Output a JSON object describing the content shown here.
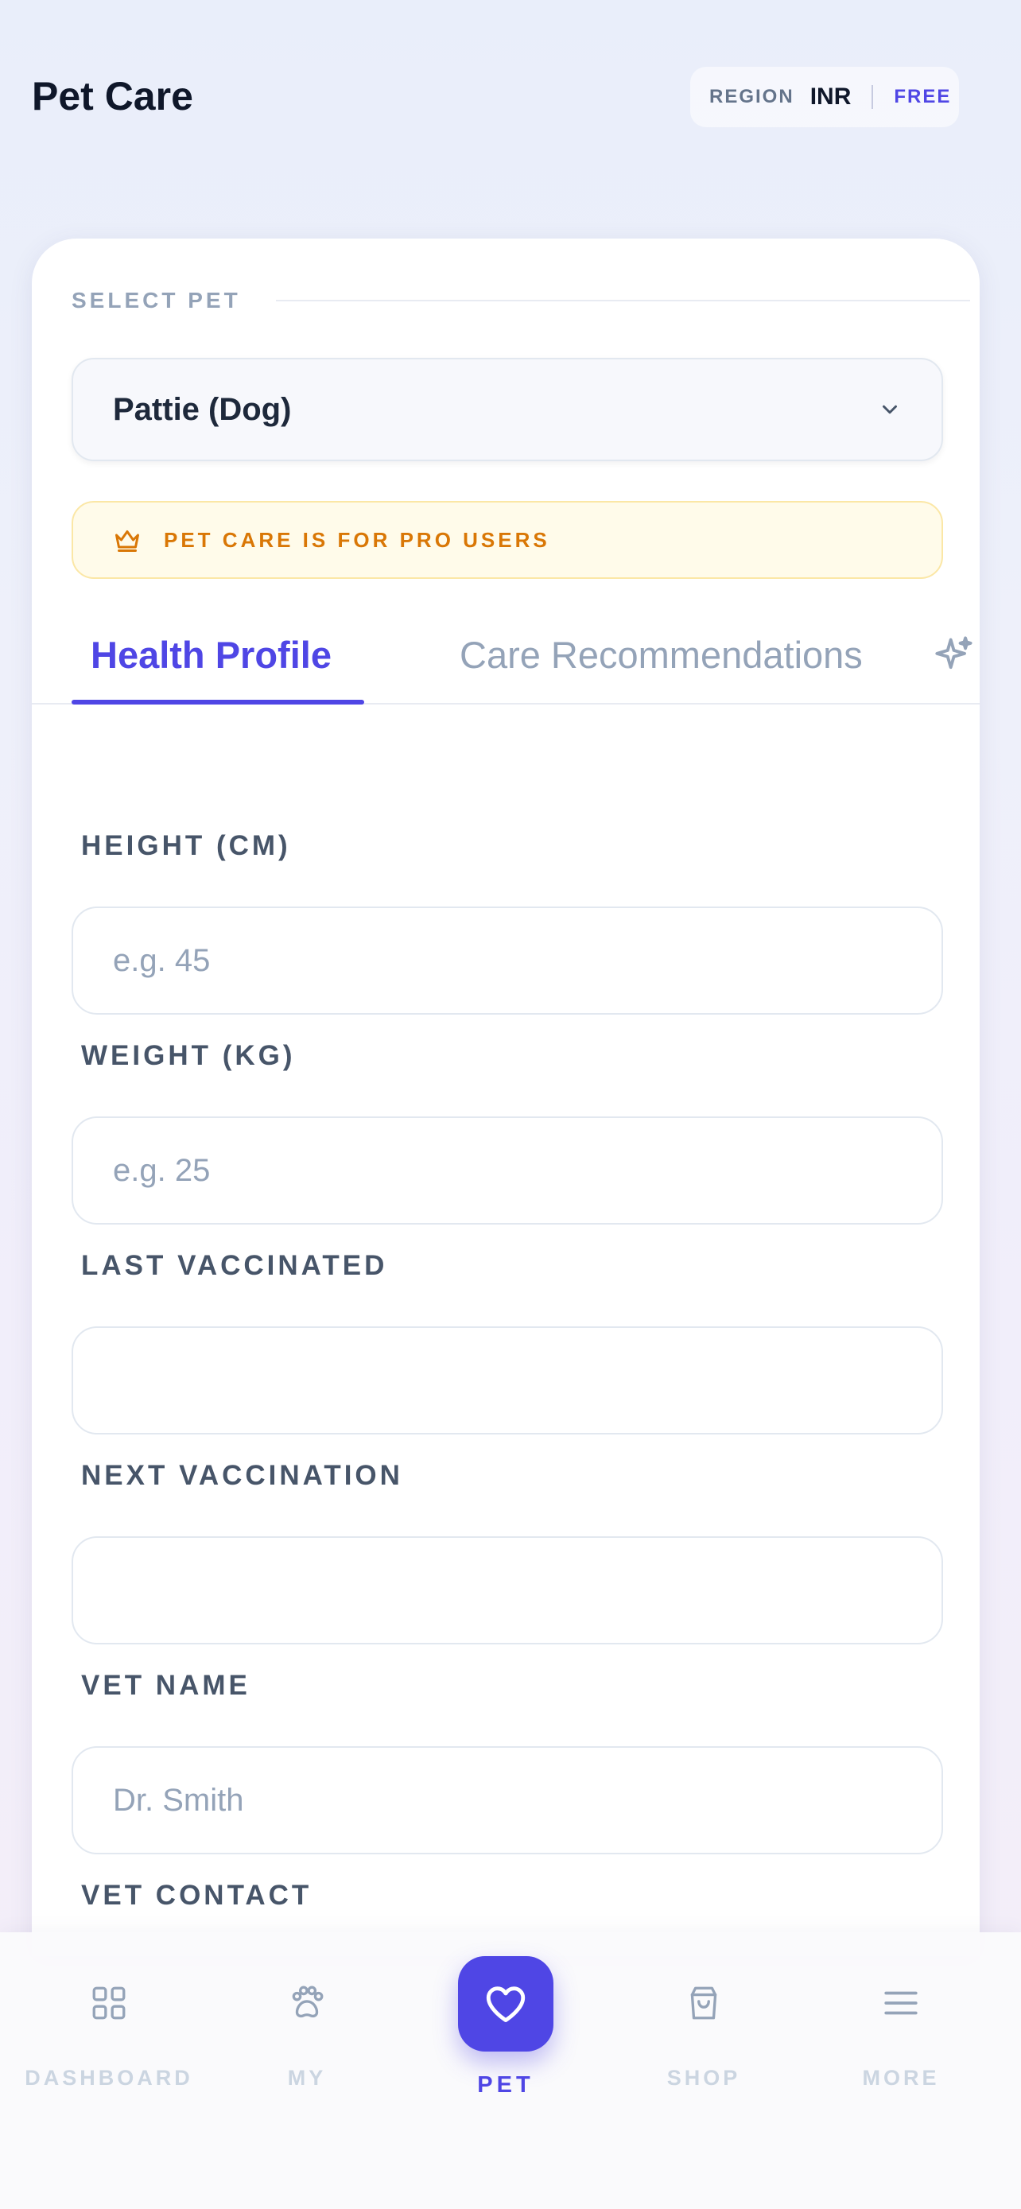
{
  "header": {
    "title": "Pet Care",
    "region_label": "REGION",
    "region_value": "INR",
    "plan_badge": "FREE"
  },
  "pet_select": {
    "label": "SELECT PET",
    "selected": "Pattie (Dog)"
  },
  "pro_banner": {
    "text": "PET CARE IS FOR PRO USERS"
  },
  "tabs": [
    {
      "label": "Health Profile",
      "active": true
    },
    {
      "label": "Care Recommendations",
      "active": false
    }
  ],
  "form": {
    "height": {
      "label": "HEIGHT (CM)",
      "value": "",
      "placeholder": "e.g. 45"
    },
    "weight": {
      "label": "WEIGHT (KG)",
      "value": "",
      "placeholder": "e.g. 25"
    },
    "last_vaccinated": {
      "label": "LAST VACCINATED",
      "value": "",
      "placeholder": ""
    },
    "next_vaccination": {
      "label": "NEXT VACCINATION",
      "value": "",
      "placeholder": ""
    },
    "vet_name": {
      "label": "VET NAME",
      "value": "",
      "placeholder": "Dr. Smith"
    },
    "vet_contact": {
      "label": "VET CONTACT"
    }
  },
  "nav": {
    "items": [
      {
        "label": "DASHBOARD",
        "icon": "grid-icon"
      },
      {
        "label": "MY",
        "icon": "paw-icon"
      },
      {
        "label": "PET",
        "icon": "heart-icon",
        "active": true
      },
      {
        "label": "SHOP",
        "icon": "shopping-bag-icon"
      },
      {
        "label": "MORE",
        "icon": "menu-icon"
      }
    ]
  },
  "colors": {
    "accent": "#4f46e5",
    "pro_banner_text": "#d97706",
    "pro_banner_bg": "#fffbea",
    "title": "#0f172a",
    "muted": "#94a3b8"
  }
}
